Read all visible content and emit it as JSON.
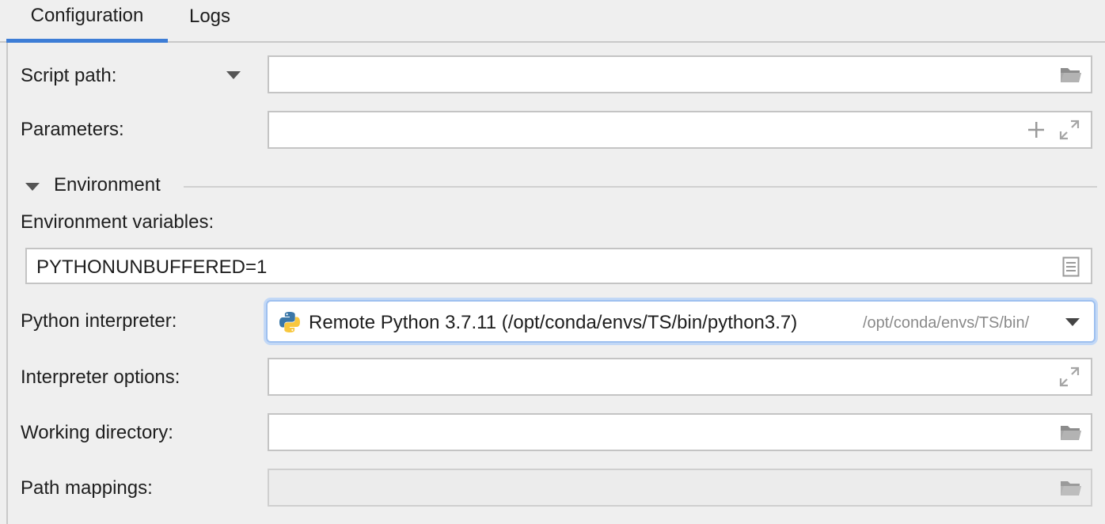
{
  "tabs": [
    {
      "label": "Configuration",
      "active": true
    },
    {
      "label": "Logs",
      "active": false
    }
  ],
  "script_path": {
    "label": "Script path:",
    "value": "",
    "icon": "folder-icon"
  },
  "parameters": {
    "label": "Parameters:",
    "value": "",
    "icons": [
      "add-icon",
      "expand-icon"
    ]
  },
  "environment": {
    "title": "Environment",
    "env_vars_label": "Environment variables:",
    "env_vars_value": "PYTHONUNBUFFERED=1"
  },
  "interpreter": {
    "label": "Python interpreter:",
    "name": "Remote Python 3.7.11 (/opt/conda/envs/TS/bin/python3.7)",
    "path_hint": "/opt/conda/envs/TS/bin/"
  },
  "interpreter_options": {
    "label": "Interpreter options:",
    "value": ""
  },
  "working_directory": {
    "label": "Working directory:",
    "value": ""
  },
  "path_mappings": {
    "label": "Path mappings:",
    "value": ""
  },
  "colors": {
    "accent": "#3d7dd6",
    "focus_ring": "#c2d8f6",
    "background": "#efefef"
  }
}
